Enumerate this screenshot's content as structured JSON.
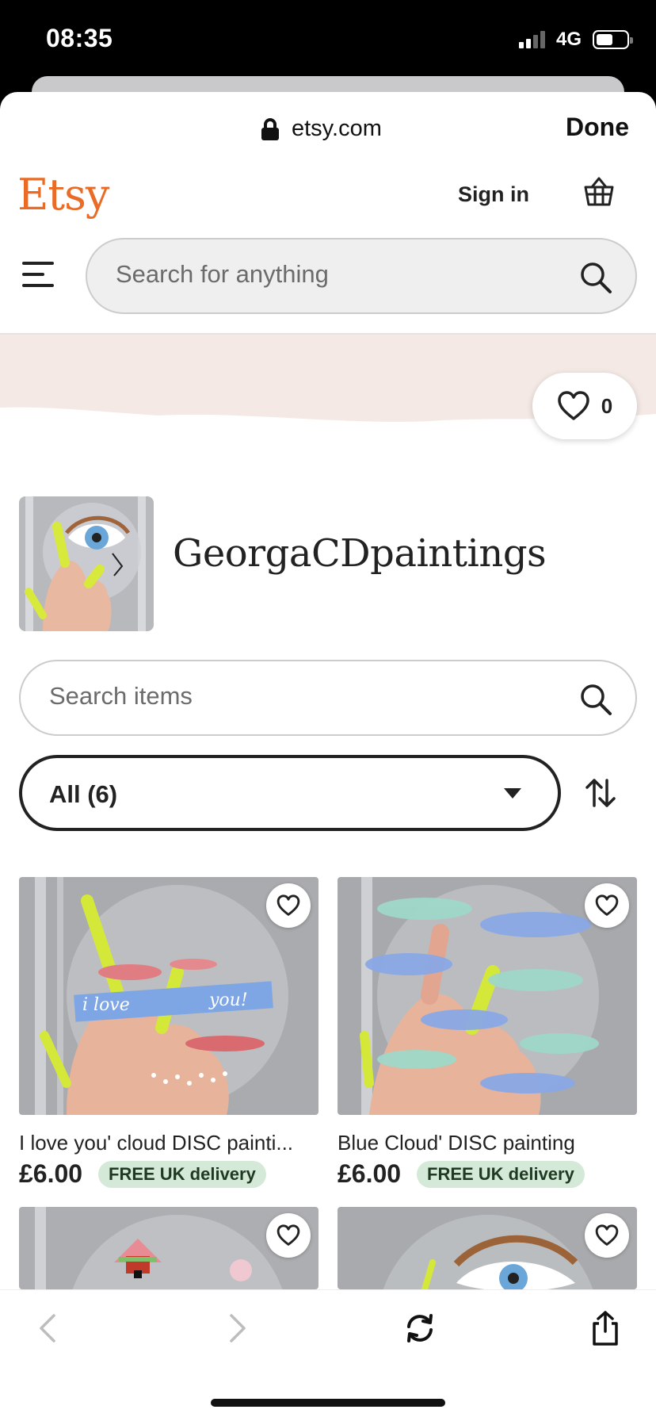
{
  "status_bar": {
    "time": "08:35",
    "network": "4G"
  },
  "browser": {
    "url": "etsy.com",
    "done_label": "Done"
  },
  "header": {
    "logo": "Etsy",
    "sign_in": "Sign in"
  },
  "search": {
    "placeholder": "Search for anything"
  },
  "shop": {
    "favorites_count": "0",
    "name": "GeorgaCDpaintings",
    "search_placeholder": "Search items",
    "filter_label": "All (6)"
  },
  "listings": [
    {
      "title": "I love you' cloud DISC painti...",
      "price": "£6.00",
      "badge": "FREE UK delivery"
    },
    {
      "title": "Blue Cloud' DISC painting",
      "price": "£6.00",
      "badge": "FREE UK delivery"
    },
    {
      "title": "",
      "price": "",
      "badge": ""
    },
    {
      "title": "",
      "price": "",
      "badge": ""
    }
  ],
  "colors": {
    "brand": "#e96b26",
    "banner": "#f4e9e5",
    "badge_bg": "#d4e9d7"
  },
  "icons": {
    "lock": "lock-icon",
    "basket": "basket-icon",
    "menu": "menu-icon",
    "search": "search-icon",
    "heart": "heart-icon",
    "sort": "sort-icon",
    "back": "back-icon",
    "forward": "forward-icon",
    "reload": "reload-icon",
    "share": "share-icon"
  }
}
